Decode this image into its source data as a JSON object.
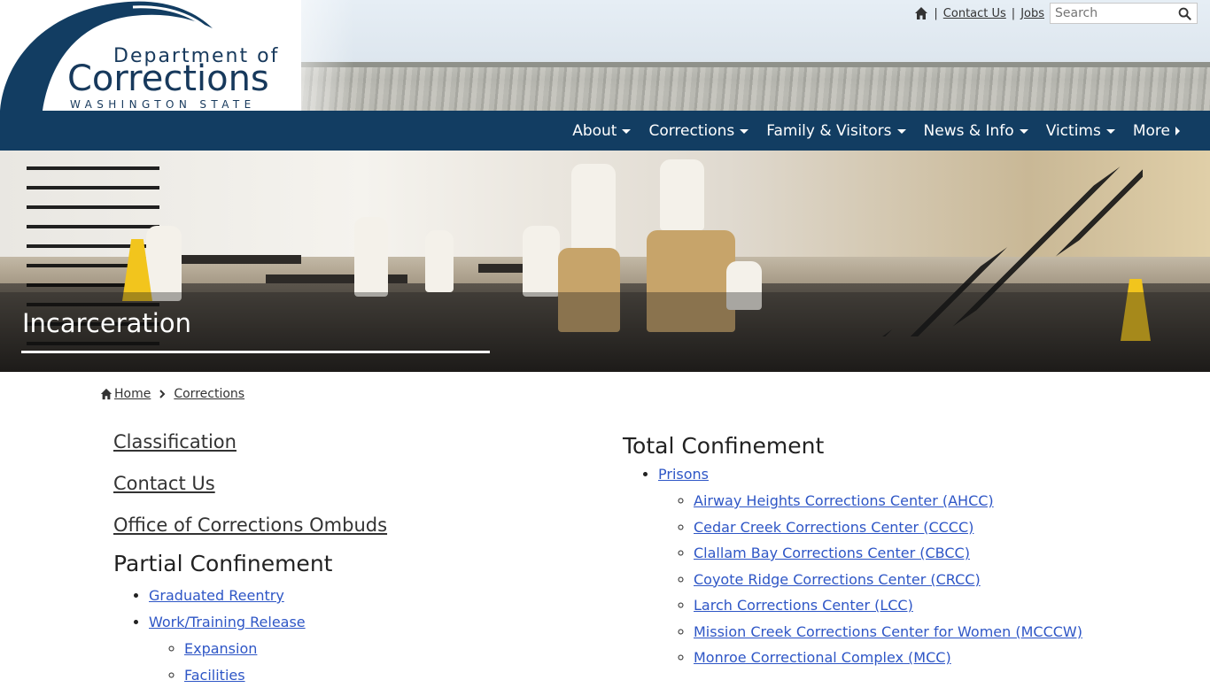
{
  "header": {
    "logo": {
      "line1": "Department of",
      "line2": "Corrections",
      "line3": "WASHINGTON STATE"
    },
    "utility": {
      "home_icon": "home-icon",
      "separator": "|",
      "contact_label": "Contact Us",
      "jobs_label": "Jobs",
      "search_placeholder": "Search",
      "search_icon": "search-icon"
    }
  },
  "nav": {
    "items": [
      {
        "label": "About",
        "icon": "caret-down-icon"
      },
      {
        "label": "Corrections",
        "icon": "caret-down-icon"
      },
      {
        "label": "Family & Visitors",
        "icon": "caret-down-icon"
      },
      {
        "label": "News & Info",
        "icon": "caret-down-icon"
      },
      {
        "label": "Victims",
        "icon": "caret-down-icon"
      },
      {
        "label": "More",
        "icon": "caret-right-icon"
      }
    ]
  },
  "hero": {
    "title": "Incarceration"
  },
  "breadcrumb": {
    "home_label": "Home",
    "current_label": "Corrections"
  },
  "left": {
    "links": [
      "Classification",
      "Contact Us",
      "Office of Corrections Ombuds"
    ],
    "partial_heading": "Partial Confinement",
    "partial_items": [
      {
        "label": "Graduated Reentry"
      },
      {
        "label": "Work/Training Release",
        "children": [
          "Expansion",
          "Facilities"
        ]
      }
    ]
  },
  "right": {
    "heading": "Total Confinement",
    "prisons_label": "Prisons",
    "prisons": [
      "Airway Heights Corrections Center (AHCC)",
      "Cedar Creek Corrections Center (CCCC)",
      "Clallam Bay Corrections Center (CBCC)",
      "Coyote Ridge Corrections Center (CRCC)",
      "Larch Corrections Center (LCC)",
      "Mission Creek Corrections Center for Women (MCCCW)",
      "Monroe Correctional Complex (MCC)"
    ]
  },
  "colors": {
    "brand_navy": "#123d62",
    "logo_navy": "#17395c",
    "link_blue": "#2e56c6"
  }
}
